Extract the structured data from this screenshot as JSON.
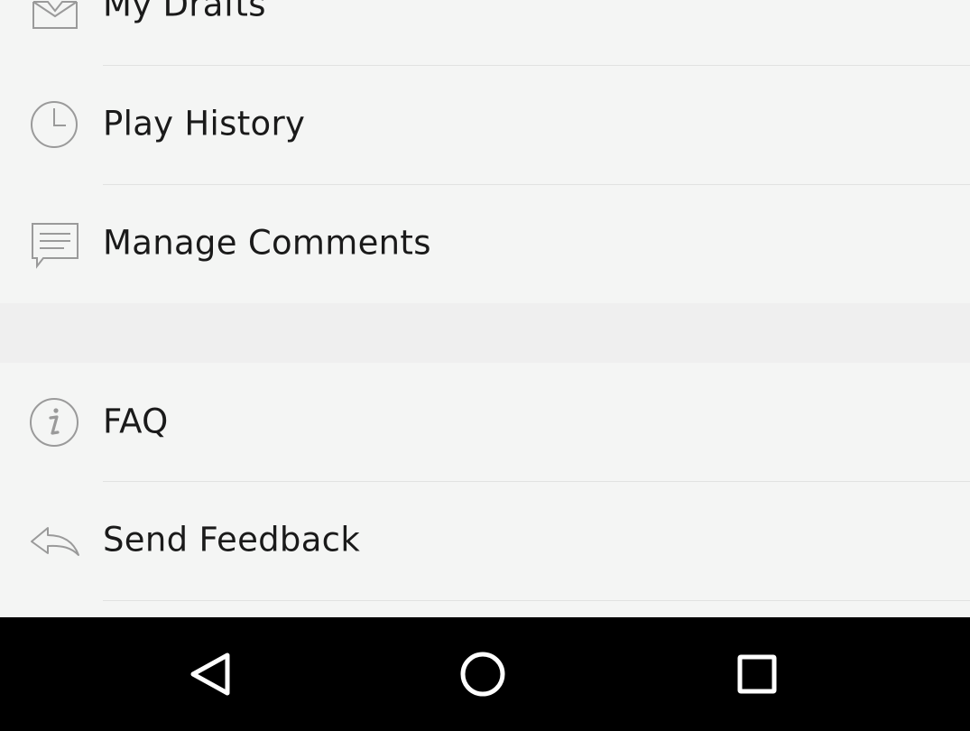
{
  "menu": {
    "items": [
      {
        "label": "My Drafts",
        "icon": "inbox-tray-icon"
      },
      {
        "label": "Play History",
        "icon": "clock-icon"
      },
      {
        "label": "Manage Comments",
        "icon": "comment-icon"
      },
      {
        "label": "FAQ",
        "icon": "info-icon"
      },
      {
        "label": "Send Feedback",
        "icon": "reply-arrow-icon"
      }
    ]
  },
  "navbar": {
    "buttons": [
      {
        "name": "back",
        "icon": "back-triangle-icon"
      },
      {
        "name": "home",
        "icon": "home-circle-icon"
      },
      {
        "name": "recents",
        "icon": "recents-square-icon"
      }
    ]
  },
  "colors": {
    "background": "#f4f5f4",
    "section_gap": "#efefef",
    "divider": "#e1e2e1",
    "icon": "#9a9a9a",
    "text": "#1a1a1a",
    "navbar": "#000000"
  }
}
